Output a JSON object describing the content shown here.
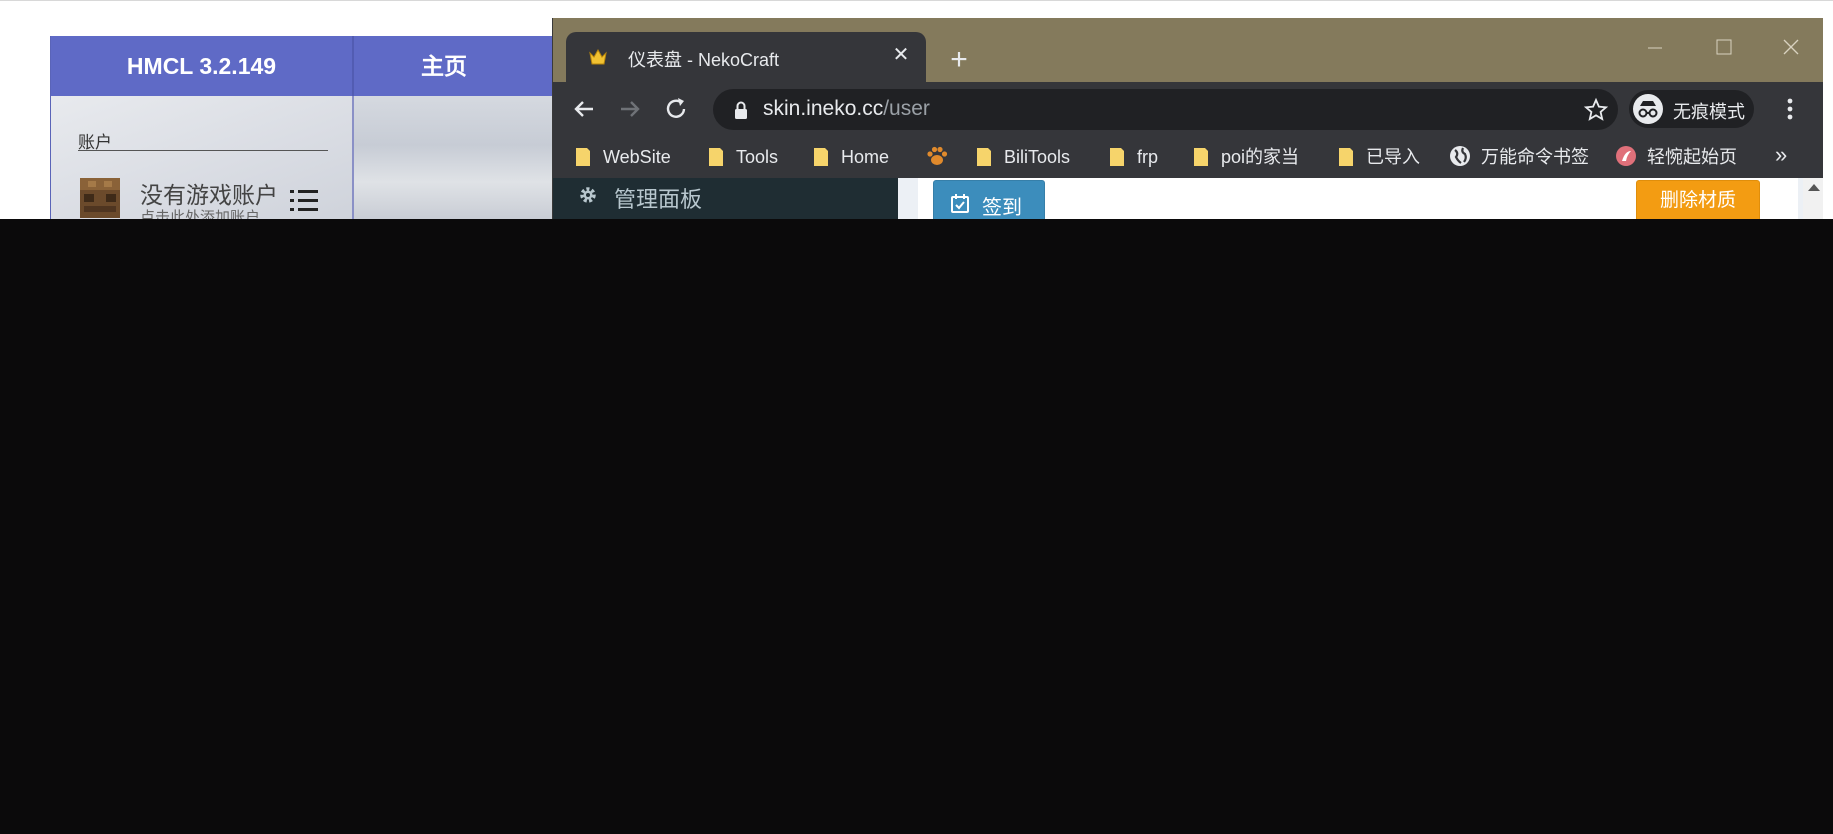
{
  "hmcl": {
    "title": "HMCL 3.2.149",
    "tab_home": "主页",
    "account_section": "账户",
    "account_name": "没有游戏账户",
    "account_hint": "点击此处添加账户"
  },
  "browser": {
    "tab_title": "仪表盘 - NekoCraft",
    "tab_close": "✕",
    "new_tab": "+",
    "url_domain": "skin.ineko.cc",
    "url_path": "/user",
    "incognito_label": "无痕模式",
    "bookmarks": [
      {
        "label": "WebSite",
        "icon": "folder-icon"
      },
      {
        "label": "Tools",
        "icon": "folder-icon"
      },
      {
        "label": "Home",
        "icon": "folder-icon"
      },
      {
        "label": "",
        "icon": "paw-icon"
      },
      {
        "label": "BiliTools",
        "icon": "folder-icon"
      },
      {
        "label": "frp",
        "icon": "folder-icon"
      },
      {
        "label": "poi的家当",
        "icon": "folder-icon"
      },
      {
        "label": "已导入",
        "icon": "folder-icon"
      },
      {
        "label": "万能命令书签",
        "icon": "globe-icon"
      },
      {
        "label": "轻惋起始页",
        "icon": "site-icon"
      }
    ],
    "bookmarks_more": "»"
  },
  "page": {
    "sidebar_item": "管理面板",
    "sign_button": "签到",
    "delete_button": "删除材质"
  },
  "colors": {
    "hmcl_header": "#5f6ac6",
    "chrome_frame": "#847a5c",
    "chrome_toolbar": "#35363a",
    "sign_button": "#3c8dbc",
    "delete_button": "#f39c12"
  }
}
